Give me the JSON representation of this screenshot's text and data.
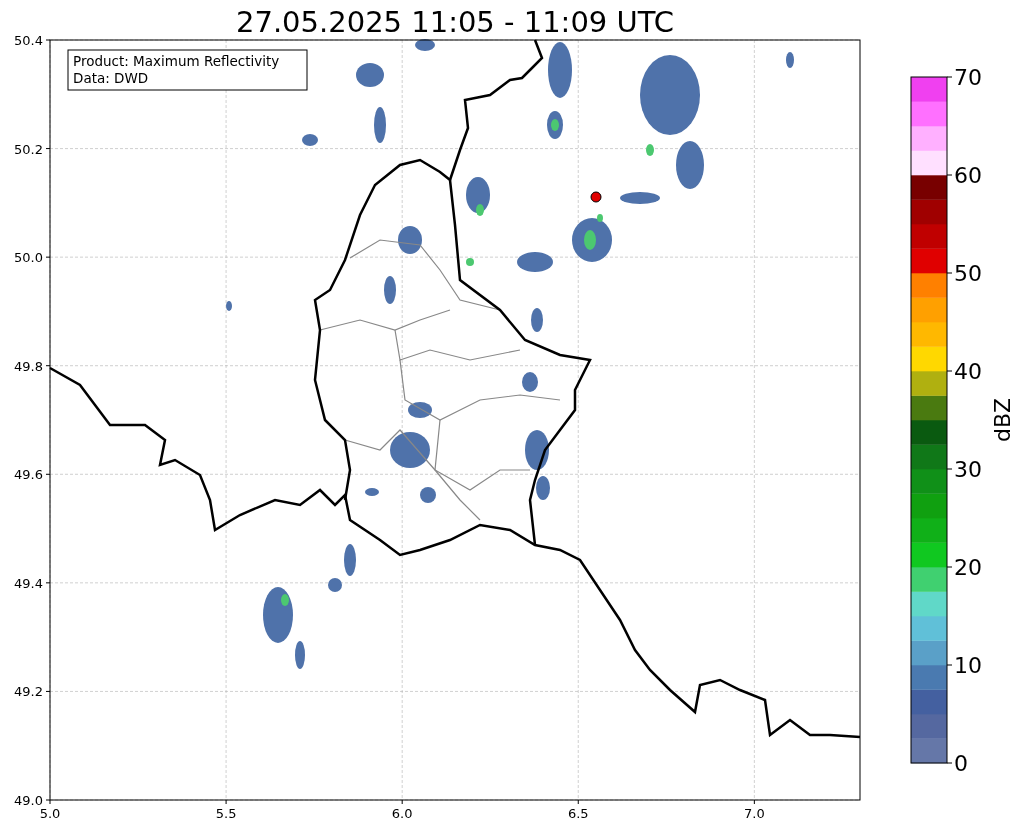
{
  "title": "27.05.2025 11:05 - 11:09 UTC",
  "legend": [
    "Product: Maximum Reflectivity",
    "Data: DWD"
  ],
  "x_ticks": [
    "5.0",
    "5.5",
    "6.0",
    "6.5",
    "7.0"
  ],
  "y_ticks": [
    "50.4",
    "50.2",
    "50.0",
    "49.8",
    "49.6",
    "49.4",
    "49.2",
    "49.0"
  ],
  "colorbar": {
    "label": "dBZ",
    "ticks": [
      "70",
      "60",
      "50",
      "40",
      "30",
      "20",
      "10",
      "0"
    ],
    "bands": [
      {
        "color": "#6577a8"
      },
      {
        "color": "#5568a0"
      },
      {
        "color": "#4460a0"
      },
      {
        "color": "#4a7ab0"
      },
      {
        "color": "#5aa0c8"
      },
      {
        "color": "#60c0d8"
      },
      {
        "color": "#60d8c8"
      },
      {
        "color": "#40d070"
      },
      {
        "color": "#10c820"
      },
      {
        "color": "#10b018"
      },
      {
        "color": "#10a010"
      },
      {
        "color": "#109018"
      },
      {
        "color": "#107818"
      },
      {
        "color": "#0a5a10"
      },
      {
        "color": "#4a7a10"
      },
      {
        "color": "#b0b010"
      },
      {
        "color": "#ffd800"
      },
      {
        "color": "#ffb800"
      },
      {
        "color": "#ffa000"
      },
      {
        "color": "#ff8000"
      },
      {
        "color": "#e00000"
      },
      {
        "color": "#c00000"
      },
      {
        "color": "#a00000"
      },
      {
        "color": "#780000"
      },
      {
        "color": "#ffe0ff"
      },
      {
        "color": "#ffb0ff"
      },
      {
        "color": "#ff70ff"
      },
      {
        "color": "#f040f0"
      }
    ]
  }
}
